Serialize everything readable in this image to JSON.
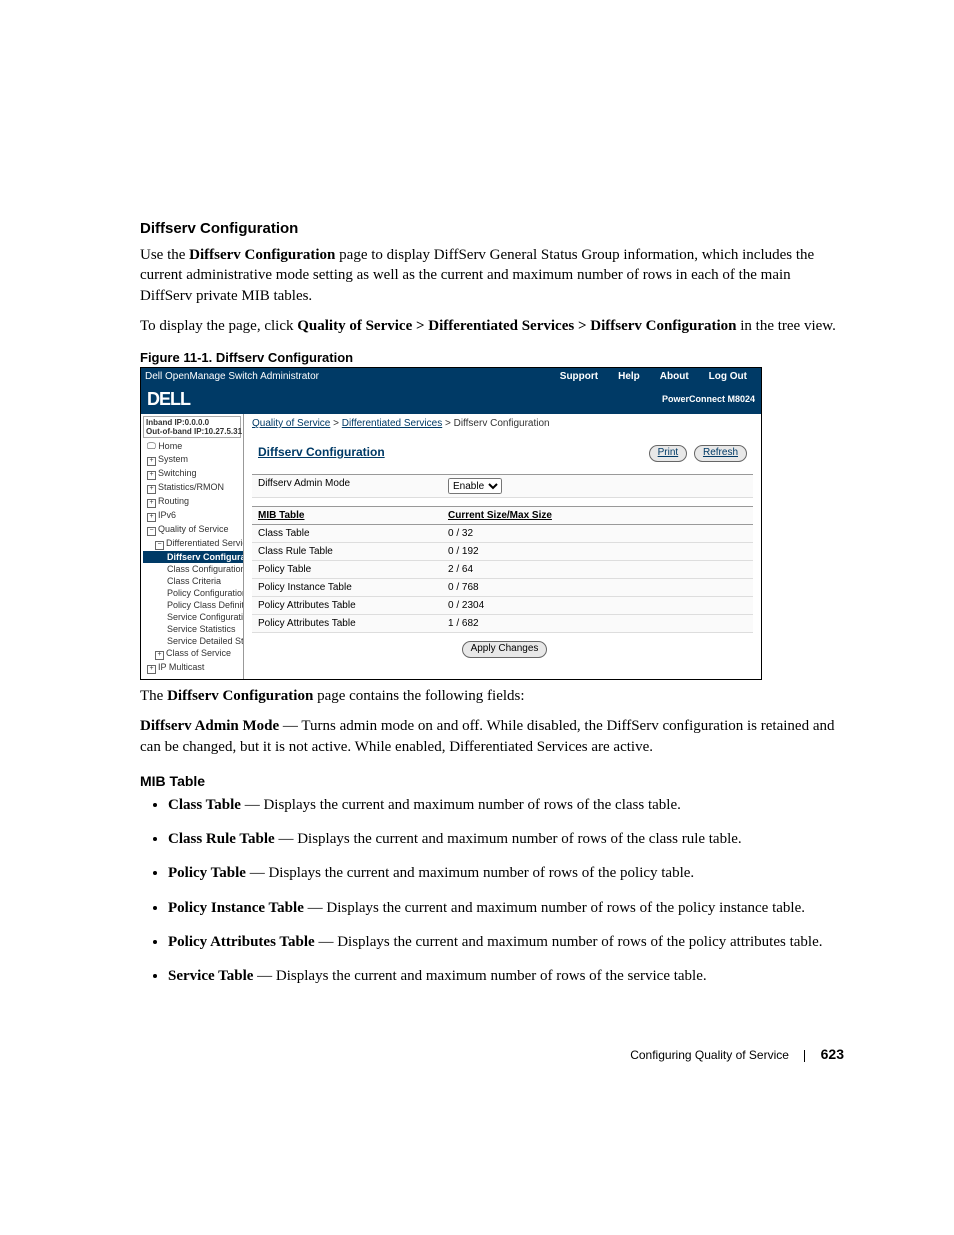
{
  "heading": "Diffserv Configuration",
  "intro_1a": "Use the ",
  "intro_1b": "Diffserv Configuration",
  "intro_1c": " page to display DiffServ General Status Group information, which includes the current administrative mode setting as well as the current and maximum number of rows in each of the main DiffServ private MIB tables.",
  "intro_2a": "To display the page, click ",
  "intro_2b": "Quality of Service > Differentiated Services > Diffserv Configuration",
  "intro_2c": " in the tree view.",
  "figure_caption": "Figure 11-1.    Diffserv Configuration",
  "ss": {
    "titlebar": {
      "title": "Dell OpenManage Switch Administrator",
      "nav": [
        "Support",
        "Help",
        "About",
        "Log Out"
      ]
    },
    "logo": "DELL",
    "product": "PowerConnect M8024",
    "ip": {
      "inband": "Inband IP:0.0.0.0",
      "oob": "Out-of-band IP:10.27.5.31"
    },
    "tree": {
      "home": "Home",
      "items": [
        "System",
        "Switching",
        "Statistics/RMON",
        "Routing",
        "IPv6",
        "Quality of Service"
      ],
      "diff": "Differentiated Services",
      "diff_items": [
        "Diffserv Configurat",
        "Class Configuration",
        "Class Criteria",
        "Policy Configuration",
        "Policy Class Definit",
        "Service Configuratio",
        "Service Statistics",
        "Service Detailed Sta"
      ],
      "cos": "Class of Service",
      "ipm": "IP Multicast"
    },
    "breadcrumb": {
      "a": "Quality of Service",
      "b": "Differentiated Services",
      "c": "Diffserv Configuration"
    },
    "panel_title": "Diffserv Configuration",
    "buttons": {
      "print": "Print",
      "refresh": "Refresh",
      "apply": "Apply Changes"
    },
    "admin_mode_label": "Diffserv Admin Mode",
    "admin_mode_value": "Enable",
    "mib_header": {
      "c1": "MIB Table",
      "c2": "Current Size/Max Size"
    },
    "mib_rows": [
      {
        "name": "Class Table",
        "val": "0 / 32"
      },
      {
        "name": "Class Rule Table",
        "val": "0 / 192"
      },
      {
        "name": "Policy Table",
        "val": "2 / 64"
      },
      {
        "name": "Policy Instance Table",
        "val": "0 / 768"
      },
      {
        "name": "Policy Attributes Table",
        "val": "0 / 2304"
      },
      {
        "name": "Policy Attributes Table",
        "val": "1 / 682"
      }
    ]
  },
  "after_1a": "The ",
  "after_1b": "Diffserv Configuration",
  "after_1c": " page contains the following fields:",
  "after_2a": "Diffserv Admin Mode",
  "after_2b": " — Turns admin mode on and off. While disabled, the DiffServ configuration is retained and can be changed, but it is not active. While enabled, Differentiated Services are active.",
  "mib_heading": "MIB Table",
  "bullets": [
    {
      "b": "Class Table",
      "t": " — Displays the current and maximum number of rows of the class table."
    },
    {
      "b": "Class Rule Table",
      "t": " — Displays the current and maximum number of rows of the class rule table."
    },
    {
      "b": "Policy Table",
      "t": " — Displays the current and maximum number of rows of the policy table."
    },
    {
      "b": "Policy Instance Table",
      "t": " — Displays the current and maximum number of rows of the policy instance table."
    },
    {
      "b": "Policy Attributes Table",
      "t": " — Displays the current and maximum number of rows of the policy attributes table."
    },
    {
      "b": "Service Table",
      "t": " — Displays the current and maximum number of rows of the service table."
    }
  ],
  "footer": {
    "section": "Configuring Quality of Service",
    "page": "623"
  }
}
